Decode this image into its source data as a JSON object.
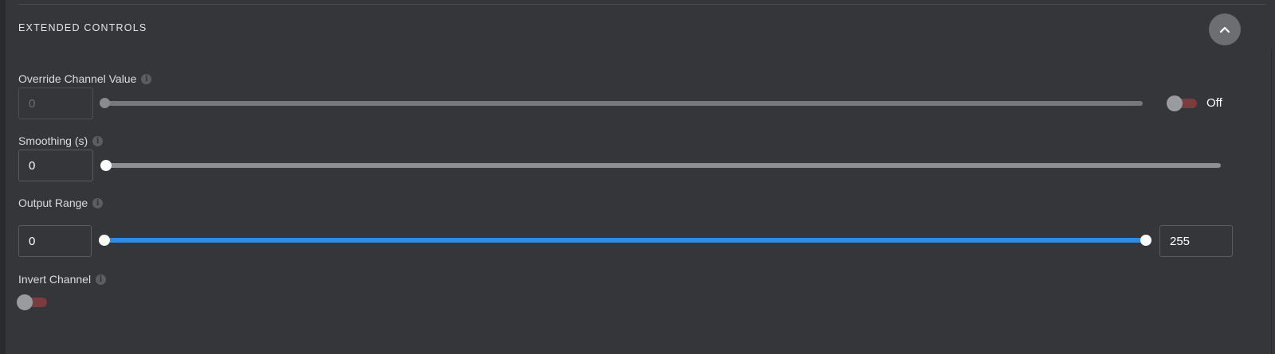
{
  "section": {
    "title": "EXTENDED CONTROLS",
    "collapse_icon": "chevron-up-icon"
  },
  "override_channel": {
    "label": "Override Channel Value",
    "value": "0",
    "slider_fraction": 0.0,
    "toggle_state": "Off",
    "toggle_on": false
  },
  "smoothing": {
    "label": "Smoothing (s)",
    "value": "0",
    "slider_fraction": 0.0
  },
  "output_range": {
    "label": "Output Range",
    "min_value": "0",
    "max_value": "255",
    "range_fraction": [
      0.0,
      1.0
    ]
  },
  "invert_channel": {
    "label": "Invert Channel",
    "toggle_on": false
  },
  "icons": {
    "info": "info-icon",
    "info_glyph": "i"
  },
  "colors": {
    "panel_bg": "#35363a",
    "active_range": "#2f8ae8",
    "toggle_off_track": "#7a3c3c"
  }
}
